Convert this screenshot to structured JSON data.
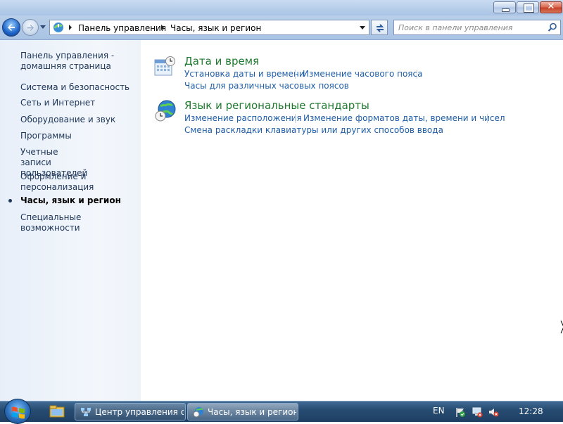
{
  "titlebar": {
    "minimize": "minimize-button",
    "maximize": "maximize-button",
    "close_glyph": "✕"
  },
  "nav": {
    "breadcrumbs": [
      "Панель управления",
      "Часы, язык и регион"
    ],
    "search_placeholder": "Поиск в панели управления"
  },
  "sidebar": {
    "items": [
      {
        "label": "Панель управления - домашняя страница"
      },
      {
        "label": "Система и безопасность"
      },
      {
        "label": "Сеть и Интернет"
      },
      {
        "label": "Оборудование и звук"
      },
      {
        "label": "Программы"
      },
      {
        "label": "Учетные записи пользователей"
      },
      {
        "label": "Оформление и персонализация"
      },
      {
        "label": "Часы, язык и регион",
        "current": true
      },
      {
        "label": "Специальные возможности"
      }
    ]
  },
  "categories": [
    {
      "title": "Дата и время",
      "icon": "calendar-clock-icon",
      "tasks": [
        "Установка даты и времени",
        "Изменение часового пояса",
        "Часы для различных часовых поясов"
      ]
    },
    {
      "title": "Язык и региональные стандарты",
      "icon": "globe-clock-icon",
      "tasks": [
        "Изменение расположения",
        "Изменение форматов даты, времени и чисел",
        "Смена раскладки клавиатуры или других способов ввода"
      ]
    }
  ],
  "taskbar": {
    "windows": [
      {
        "label": "Центр управления с...",
        "icon": "network-center-icon"
      },
      {
        "label": "Часы, язык и регион",
        "icon": "globe-clock-icon",
        "active": true
      }
    ],
    "language": "EN",
    "time": "12:28"
  },
  "colors": {
    "link": "#1f5ea8",
    "category_title": "#1f7a2e",
    "sidebar_link": "#1d3557"
  }
}
